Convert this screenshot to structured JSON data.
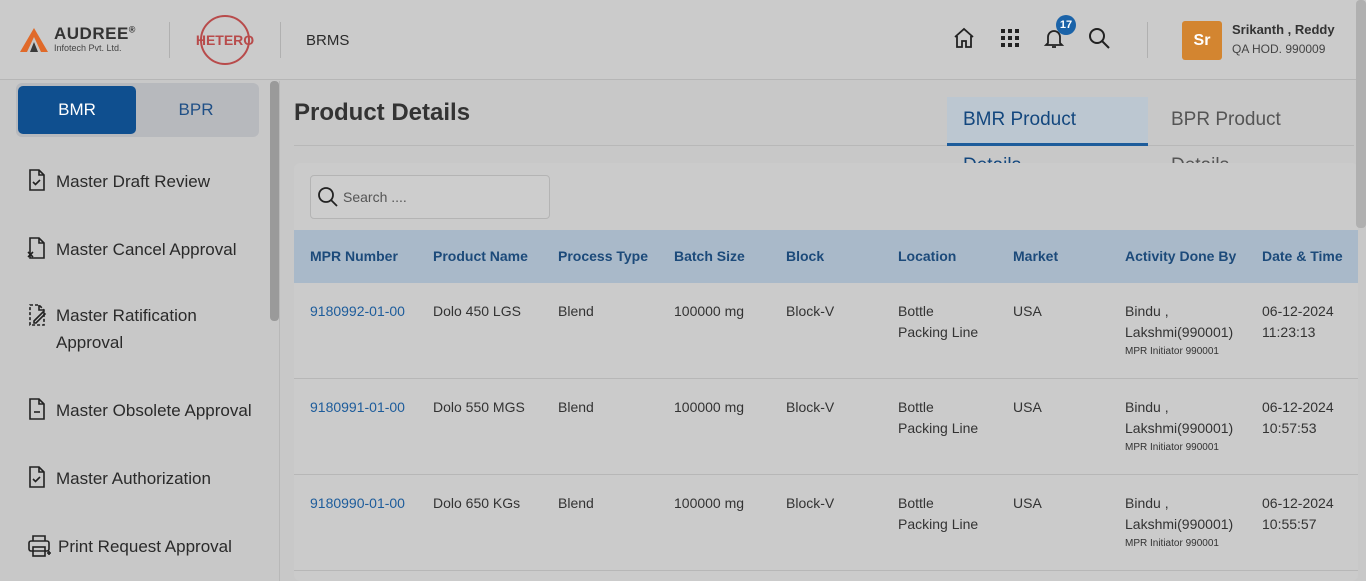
{
  "header": {
    "brand": {
      "name": "AUDREE",
      "reg": "®",
      "sub": "Infotech Pvt. Ltd."
    },
    "client_logo": "HETERO",
    "app_name": "BRMS",
    "icons": [
      "home-icon",
      "apps-grid-icon",
      "bell-icon",
      "search-icon"
    ],
    "notification_count": "17",
    "user": {
      "initials": "Sr",
      "name": "Srikanth , Reddy",
      "role": "QA HOD. 990009"
    },
    "colors": {
      "avatar": "#d38530",
      "badge": "#1b63a8"
    }
  },
  "sidebar": {
    "toggle": {
      "active": "BMR",
      "inactive": "BPR"
    },
    "items": [
      {
        "label": "Master Draft Review",
        "icon": "doc-check-icon"
      },
      {
        "label": "Master Cancel Approval",
        "icon": "doc-cancel-icon"
      },
      {
        "label": "Master Ratification",
        "label2": "Approval",
        "icon": "doc-edit-icon"
      },
      {
        "label": "Master Obsolete Approval",
        "icon": "doc-minus-icon"
      },
      {
        "label": "Master Authorization",
        "icon": "doc-check-icon"
      },
      {
        "label": "Print Request Approval",
        "icon": "printer-icon"
      }
    ]
  },
  "main": {
    "title": "Product Details",
    "tabs": [
      {
        "label": "BMR Product Details",
        "active": true
      },
      {
        "label": "BPR Product Details",
        "active": false
      }
    ],
    "search": {
      "placeholder": "Search ...."
    },
    "columns": [
      "MPR Number",
      "Product Name",
      "Process Type",
      "Batch Size",
      "Block",
      "Location",
      "Market",
      "Activity Done By",
      "Date & Time"
    ],
    "rows": [
      {
        "mpr": "9180992-01-00",
        "product": "Dolo 450 LGS",
        "process": "Blend",
        "batch": "100000 mg",
        "block": "Block-V",
        "loc1": "Bottle",
        "loc2": "Packing Line",
        "market": "USA",
        "by1": "Bindu ,",
        "by2": "Lakshmi(990001)",
        "by3": "MPR Initiator 990001",
        "date": "06-12-2024",
        "time": "11:23:13"
      },
      {
        "mpr": "9180991-01-00",
        "product": "Dolo 550 MGS",
        "process": "Blend",
        "batch": "100000 mg",
        "block": "Block-V",
        "loc1": "Bottle",
        "loc2": "Packing Line",
        "market": "USA",
        "by1": "Bindu ,",
        "by2": "Lakshmi(990001)",
        "by3": "MPR Initiator 990001",
        "date": "06-12-2024",
        "time": "10:57:53"
      },
      {
        "mpr": "9180990-01-00",
        "product": "Dolo 650 KGs",
        "process": "Blend",
        "batch": "100000 mg",
        "block": "Block-V",
        "loc1": "Bottle",
        "loc2": "Packing Line",
        "market": "USA",
        "by1": "Bindu ,",
        "by2": "Lakshmi(990001)",
        "by3": "MPR Initiator 990001",
        "date": "06-12-2024",
        "time": "10:55:57"
      }
    ]
  }
}
